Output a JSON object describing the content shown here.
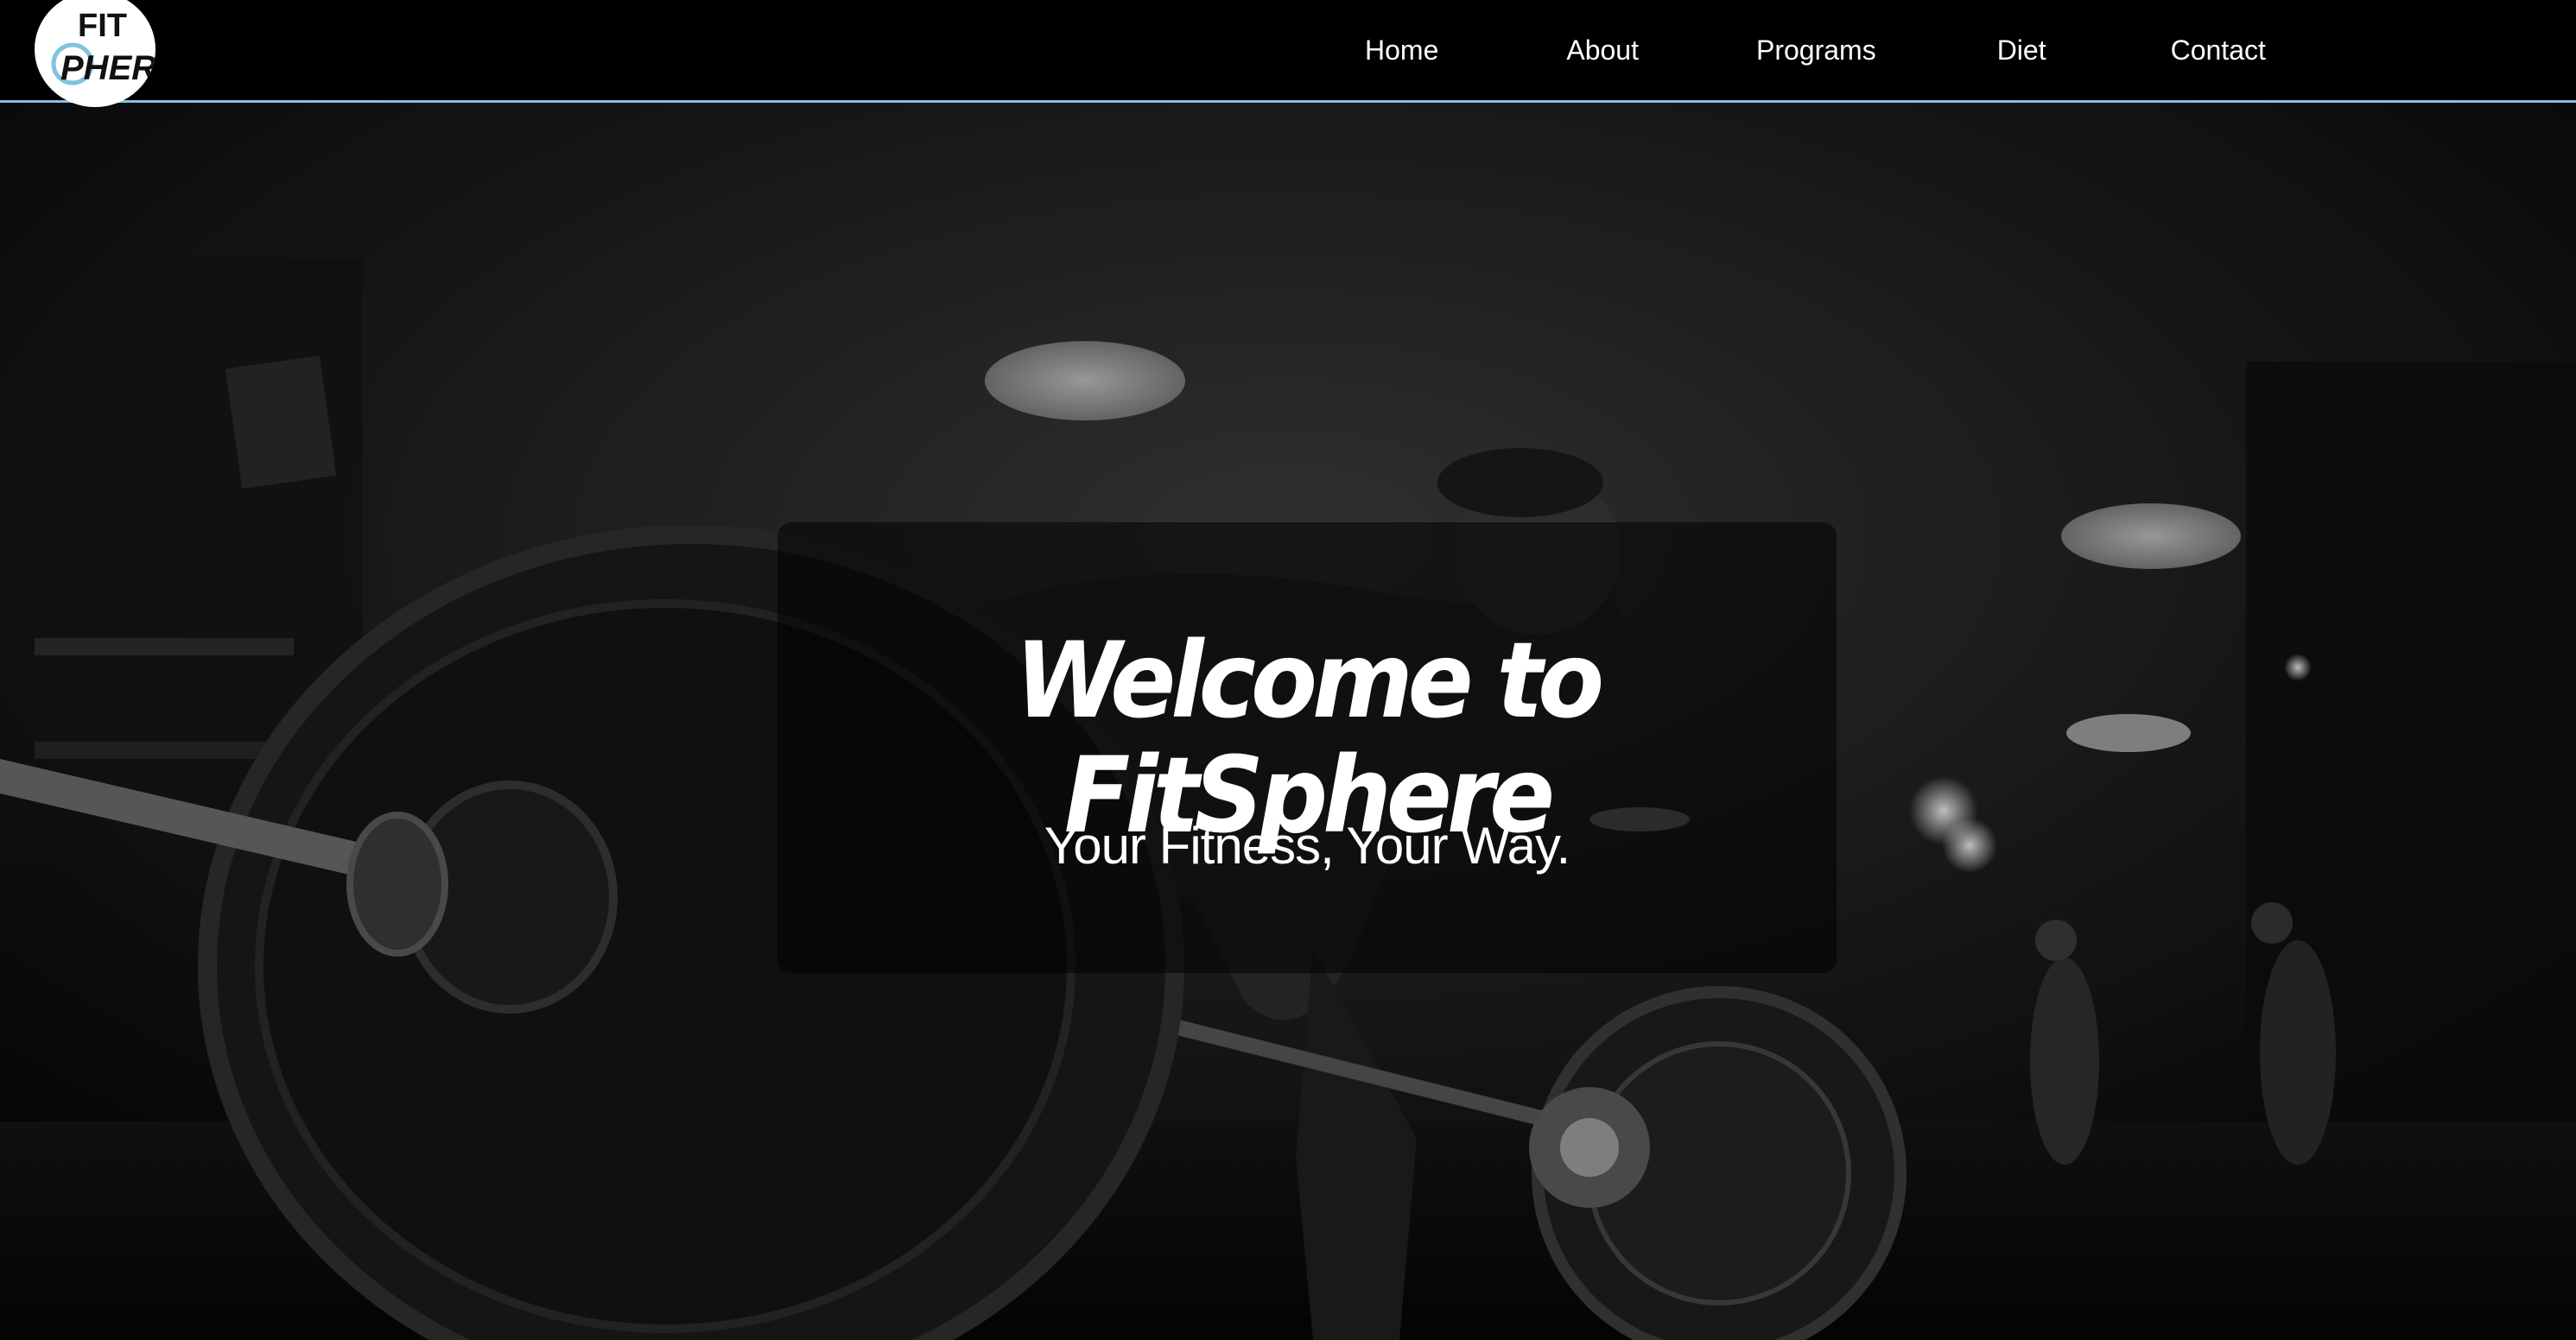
{
  "brand": {
    "logo_line1": "FIT",
    "logo_line2": "PHERE",
    "logo_accent_color": "#7fc3de"
  },
  "nav": {
    "items": [
      {
        "label": "Home"
      },
      {
        "label": "About"
      },
      {
        "label": "Programs"
      },
      {
        "label": "Diet"
      },
      {
        "label": "Contact"
      }
    ],
    "border_color": "#7fc3de"
  },
  "hero": {
    "title": "Welcome to FitSphere",
    "subtitle": "Your Fitness, Your Way."
  }
}
